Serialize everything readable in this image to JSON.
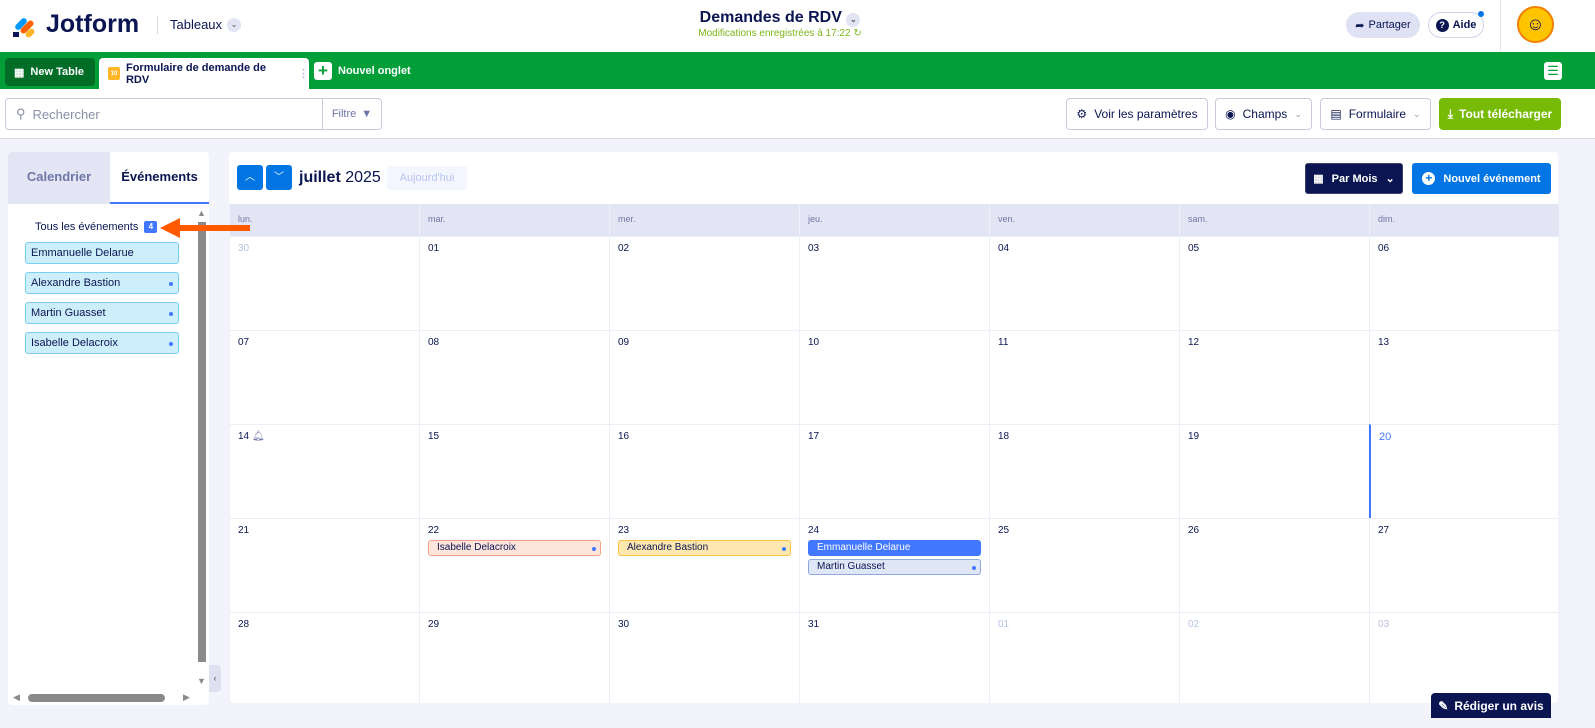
{
  "header": {
    "brand": "Jotform",
    "section": "Tableaux",
    "title": "Demandes de RDV",
    "saved_status": "Modifications enregistrées à 17:22",
    "share": "Partager",
    "help": "Aide"
  },
  "tabs": {
    "new_table": "New Table",
    "active_tab": "Formulaire de demande de RDV",
    "new_tab": "Nouvel onglet"
  },
  "toolbar": {
    "search_placeholder": "Rechercher",
    "filter": "Filtre",
    "settings": "Voir les paramètres",
    "fields": "Champs",
    "form": "Formulaire",
    "download_all": "Tout télécharger"
  },
  "sidebar": {
    "tabs": [
      "Calendrier",
      "Événements"
    ],
    "all_events": "Tous les événements",
    "count": "4",
    "events": [
      {
        "name": "Emmanuelle Delarue",
        "dot": false
      },
      {
        "name": "Alexandre Bastion",
        "dot": true
      },
      {
        "name": "Martin Guasset",
        "dot": true
      },
      {
        "name": "Isabelle Delacroix",
        "dot": true
      }
    ]
  },
  "calendar": {
    "month": "juillet",
    "year": "2025",
    "today": "Aujourd'hui",
    "view": "Par Mois",
    "new_event": "Nouvel événement",
    "weekdays": [
      "lun.",
      "mar.",
      "mer.",
      "jeu.",
      "ven.",
      "sam.",
      "dim."
    ],
    "weeks": [
      [
        {
          "d": "30",
          "m": true
        },
        {
          "d": "01"
        },
        {
          "d": "02"
        },
        {
          "d": "03"
        },
        {
          "d": "04"
        },
        {
          "d": "05"
        },
        {
          "d": "06"
        }
      ],
      [
        {
          "d": "07"
        },
        {
          "d": "08"
        },
        {
          "d": "09"
        },
        {
          "d": "10"
        },
        {
          "d": "11"
        },
        {
          "d": "12"
        },
        {
          "d": "13"
        }
      ],
      [
        {
          "d": "14",
          "bell": true
        },
        {
          "d": "15"
        },
        {
          "d": "16"
        },
        {
          "d": "17"
        },
        {
          "d": "18"
        },
        {
          "d": "19"
        },
        {
          "d": "20",
          "today": true
        }
      ],
      [
        {
          "d": "21"
        },
        {
          "d": "22",
          "events": [
            {
              "name": "Isabelle Delacroix",
              "bg": "#fde5dc",
              "border": "#f5a08a",
              "color": "#0a1551",
              "dot": true
            }
          ]
        },
        {
          "d": "23",
          "events": [
            {
              "name": "Alexandre Bastion",
              "bg": "#ffe8b0",
              "border": "#f6c042",
              "color": "#0a1551",
              "dot": true
            }
          ]
        },
        {
          "d": "24",
          "events": [
            {
              "name": "Emmanuelle Delarue",
              "bg": "#4277ff",
              "border": "#4277ff",
              "color": "#ffffff",
              "dot": false
            },
            {
              "name": "Martin Guasset",
              "bg": "#dfe6f5",
              "border": "#8fa8dd",
              "color": "#0a1551",
              "dot": true
            }
          ]
        },
        {
          "d": "25"
        },
        {
          "d": "26"
        },
        {
          "d": "27"
        }
      ],
      [
        {
          "d": "28"
        },
        {
          "d": "29"
        },
        {
          "d": "30"
        },
        {
          "d": "31"
        },
        {
          "d": "01",
          "m": true
        },
        {
          "d": "02",
          "m": true
        },
        {
          "d": "03",
          "m": true
        }
      ]
    ]
  },
  "review": "Rédiger un avis"
}
